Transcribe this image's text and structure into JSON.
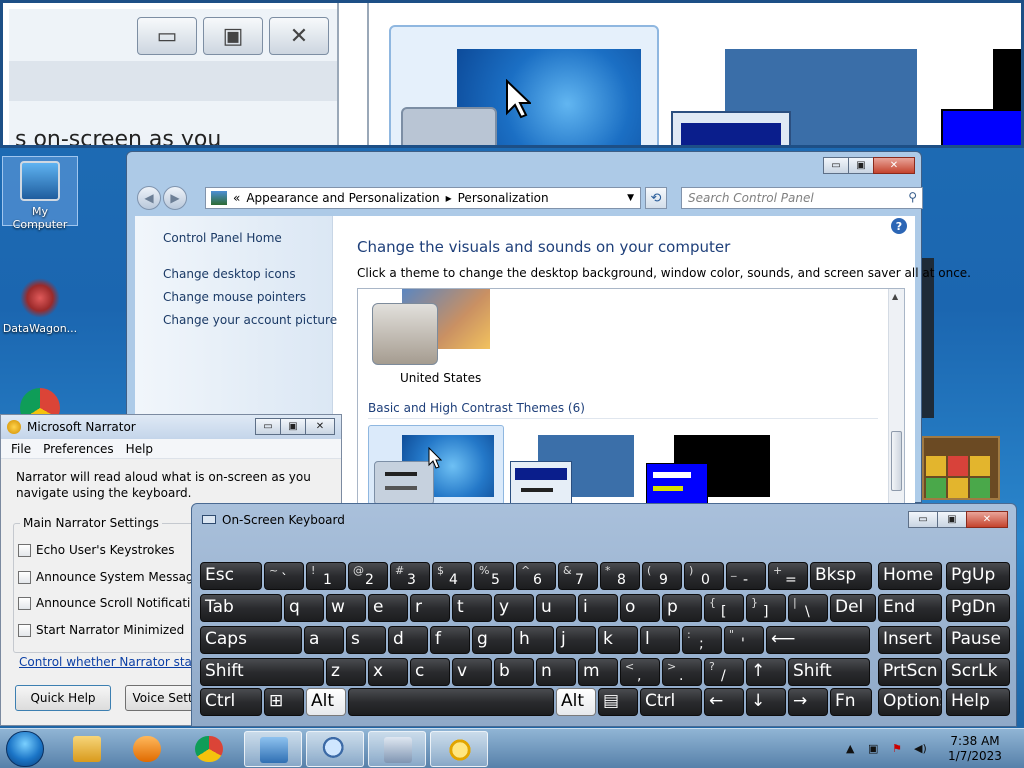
{
  "colors": {
    "accent": "#1e3f7a",
    "link": "#0b3fa5",
    "taskbar": "#7aa2c8",
    "osk_key": "#2a2b2e"
  },
  "magnifier": {
    "fragment_text": "s on-screen as you"
  },
  "desktop": {
    "icons": [
      {
        "label": "My Computer",
        "icon": "computer-icon"
      },
      {
        "label": "DataWagon...",
        "icon": "datawagon-icon"
      },
      {
        "label": "",
        "icon": "chrome-icon"
      }
    ]
  },
  "control_panel": {
    "window_buttons": {
      "minimize": "▭",
      "maximize": "▣",
      "close": "✕"
    },
    "breadcrumb": {
      "prefix": "«",
      "part1": "Appearance and Personalization",
      "separator": "▸",
      "part2": "Personalization"
    },
    "search_placeholder": "Search Control Panel",
    "sidebar": {
      "home": "Control Panel Home",
      "links": [
        "Change desktop icons",
        "Change mouse pointers",
        "Change your account picture"
      ]
    },
    "title": "Change the visuals and sounds on your computer",
    "subtitle": "Click a theme to change the desktop background, window color, sounds, and screen saver all at once.",
    "themes": {
      "installed": [
        {
          "name": "United States"
        }
      ],
      "basic_header": "Basic and High Contrast Themes (6)"
    }
  },
  "narrator": {
    "title": "Microsoft Narrator",
    "menu": [
      "File",
      "Preferences",
      "Help"
    ],
    "description": "Narrator will read aloud what is on-screen as you navigate using the keyboard.",
    "group_label": "Main Narrator Settings",
    "options": [
      {
        "label": "Echo User's Keystrokes",
        "checked": false
      },
      {
        "label": "Announce System Messages",
        "checked": false
      },
      {
        "label": "Announce Scroll Notifications",
        "checked": false
      },
      {
        "label": "Start Narrator Minimized",
        "checked": false
      }
    ],
    "link": "Control whether Narrator starts when I log on",
    "buttons": {
      "quick_help": "Quick Help",
      "voice_settings": "Voice Settings"
    }
  },
  "osk": {
    "title": "On-Screen Keyboard",
    "row1": [
      {
        "label": "Esc"
      },
      {
        "top": "~",
        "main": "`"
      },
      {
        "top": "!",
        "main": "1"
      },
      {
        "top": "@",
        "main": "2"
      },
      {
        "top": "#",
        "main": "3"
      },
      {
        "top": "$",
        "main": "4"
      },
      {
        "top": "%",
        "main": "5"
      },
      {
        "top": "^",
        "main": "6"
      },
      {
        "top": "&",
        "main": "7"
      },
      {
        "top": "*",
        "main": "8"
      },
      {
        "top": "(",
        "main": "9"
      },
      {
        "top": ")",
        "main": "0"
      },
      {
        "top": "_",
        "main": "-"
      },
      {
        "top": "+",
        "main": "="
      },
      {
        "label": "Bksp"
      }
    ],
    "row2": [
      "Tab",
      "q",
      "w",
      "e",
      "r",
      "t",
      "y",
      "u",
      "i",
      "o",
      "p",
      {
        "top": "{",
        "main": "["
      },
      {
        "top": "}",
        "main": "]"
      },
      {
        "top": "|",
        "main": "\\"
      },
      "Del"
    ],
    "row3": [
      "Caps",
      "a",
      "s",
      "d",
      "f",
      "g",
      "h",
      "j",
      "k",
      "l",
      {
        "top": ":",
        "main": ";"
      },
      {
        "top": "\"",
        "main": "'"
      },
      "⟵"
    ],
    "row4": [
      "Shift",
      "z",
      "x",
      "c",
      "v",
      "b",
      "n",
      "m",
      {
        "top": "<",
        "main": ","
      },
      {
        "top": ">",
        "main": "."
      },
      {
        "top": "?",
        "main": "/"
      },
      "↑",
      "Shift"
    ],
    "row5": [
      "Ctrl",
      "⊞",
      "Alt",
      "",
      "Alt",
      "▤",
      "Ctrl",
      "←",
      "↓",
      "→",
      "Fn"
    ],
    "nav": [
      "Home",
      "PgUp",
      "End",
      "PgDn",
      "Insert",
      "Pause",
      "PrtScn",
      "ScrLk",
      "Options",
      "Help"
    ]
  },
  "taskbar": {
    "time": "7:38 AM",
    "date": "1/7/2023",
    "apps": [
      "explorer-icon",
      "media-player-icon",
      "chrome-icon",
      "control-panel-icon",
      "magnifier-icon",
      "keyboard-icon",
      "narrator-icon"
    ]
  }
}
